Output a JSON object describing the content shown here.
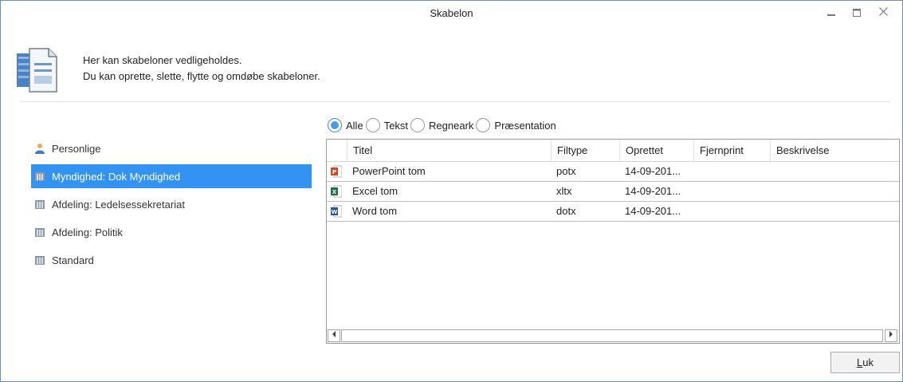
{
  "window": {
    "title": "Skabelon",
    "controls": {
      "minimize": "minimize-icon",
      "maximize": "maximize-icon",
      "close": "close-icon"
    }
  },
  "header": {
    "icon": "templates-icon",
    "line1": "Her kan skabeloner vedligeholdes.",
    "line2": "Du kan oprette, slette, flytte og omdøbe skabeloner."
  },
  "filters": [
    {
      "label": "Alle",
      "checked": true
    },
    {
      "label": "Tekst",
      "checked": false
    },
    {
      "label": "Regneark",
      "checked": false
    },
    {
      "label": "Præsentation",
      "checked": false
    }
  ],
  "tree": [
    {
      "label": "Personlige",
      "icon": "user-icon",
      "selected": false
    },
    {
      "label": "Myndighed: Dok Myndighed",
      "icon": "database-icon",
      "selected": true
    },
    {
      "label": "Afdeling: Ledelsessekretariat",
      "icon": "database-icon",
      "selected": false
    },
    {
      "label": "Afdeling: Politik",
      "icon": "database-icon",
      "selected": false
    },
    {
      "label": "Standard",
      "icon": "database-icon",
      "selected": false
    }
  ],
  "grid": {
    "columns": [
      "Titel",
      "Filtype",
      "Oprettet",
      "Fjernprint",
      "Beskrivelse"
    ],
    "rows": [
      {
        "icon": "powerpoint-icon",
        "title": "PowerPoint tom",
        "filetype": "potx",
        "created": "14-09-201...",
        "remote": "",
        "description": ""
      },
      {
        "icon": "excel-icon",
        "title": "Excel tom",
        "filetype": "xltx",
        "created": "14-09-201...",
        "remote": "",
        "description": ""
      },
      {
        "icon": "word-icon",
        "title": "Word tom",
        "filetype": "dotx",
        "created": "14-09-201...",
        "remote": "",
        "description": ""
      }
    ]
  },
  "buttons": {
    "close_prefix": "L",
    "close_rest": "uk"
  },
  "colors": {
    "selection": "#3393f2",
    "border": "#6d8fb3",
    "radio_checked": "#4a9be6"
  }
}
